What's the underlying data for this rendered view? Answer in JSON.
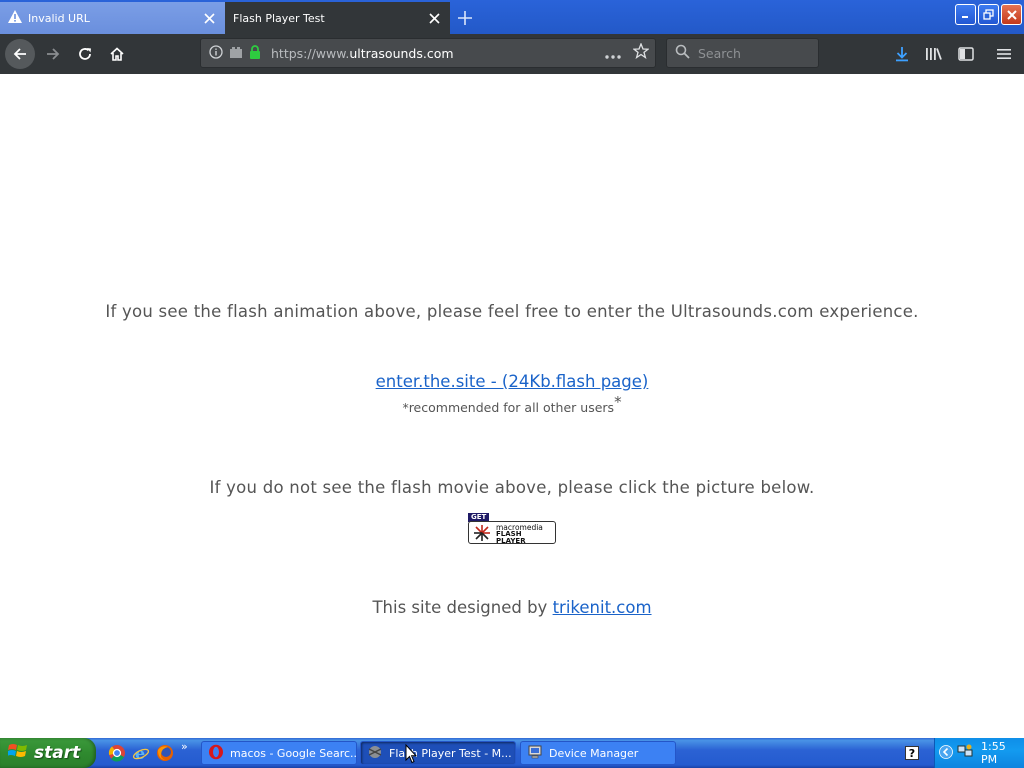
{
  "browser": {
    "tabs": [
      {
        "label": "Invalid URL",
        "active": false
      },
      {
        "label": "Flash Player Test",
        "active": true
      }
    ],
    "url_prefix": "https://www.",
    "url_domain": "ultrasounds",
    "url_suffix": ".com",
    "search_placeholder": "Search"
  },
  "page": {
    "lead_text": "If you see the flash animation above, please feel free to enter the Ultrasounds.com experience.",
    "enter_link": "enter.the.site - (24Kb.flash page)",
    "recommended": "*recommended for all other users",
    "recommended_star": "*",
    "not_see_text": "If you do not see the flash movie above, please click the picture below.",
    "badge_get": "GET",
    "badge_macromedia": "macromedia",
    "badge_flash": "FLASH",
    "badge_player": "PLAYER",
    "designed_by": "This site designed by",
    "designer_link": "trikenit.com"
  },
  "taskbar": {
    "start_label": "start",
    "more": "»",
    "tasks": [
      {
        "label": "macos - Google Searc..."
      },
      {
        "label": "Flash Player Test - M..."
      },
      {
        "label": "Device Manager"
      }
    ],
    "help": "?",
    "clock": "1:55 PM"
  },
  "colors": {
    "link": "#1a63c9",
    "toolbar": "#323639",
    "xp_blue": "#245bcf",
    "xp_start_green": "#2f8a2f"
  }
}
